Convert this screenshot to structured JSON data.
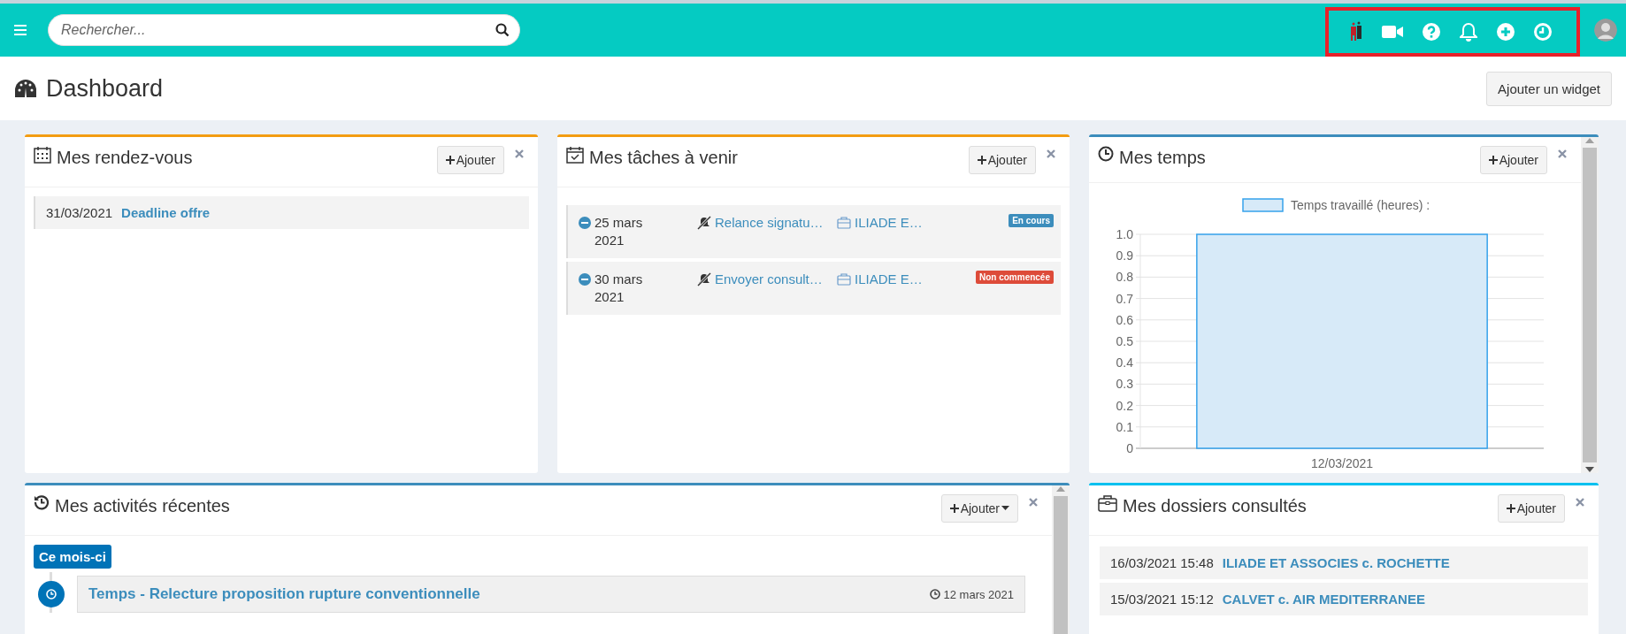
{
  "topbar": {
    "search_placeholder": "Rechercher..."
  },
  "header": {
    "title": "Dashboard",
    "add_widget_button": "Ajouter un widget"
  },
  "widgets": [
    {
      "kind": "appointments",
      "title": "Mes rendez-vous",
      "add_label": "Ajouter",
      "dropdown": false,
      "color": "#f39c12",
      "items": [
        {
          "date": "31/03/2021",
          "label": "Deadline offre"
        }
      ]
    },
    {
      "kind": "tasks",
      "title": "Mes tâches à venir",
      "add_label": "Ajouter",
      "dropdown": false,
      "color": "#f39c12",
      "tasks": [
        {
          "date": "25 mars 2021",
          "task": "Relance signatu…",
          "dossier": "ILIADE E…",
          "status": {
            "label": "En cours",
            "color": "#3c8dbc"
          }
        },
        {
          "date": "30 mars 2021",
          "task": "Envoyer consult…",
          "dossier": "ILIADE E…",
          "status": {
            "label": "Non commencée",
            "color": "#dd4b39"
          }
        }
      ]
    },
    {
      "kind": "chart",
      "title": "Mes temps",
      "add_label": "Ajouter",
      "dropdown": false,
      "color": "#3c8dbc",
      "chart_data": {
        "type": "bar",
        "categories": [
          "12/03/2021"
        ],
        "series": [
          {
            "name": "Temps travaillé (heures) :",
            "color": "#36a2eb",
            "values": [
              1
            ]
          }
        ],
        "ylim": [
          0,
          1
        ],
        "grid": true,
        "yticks": [
          {
            "value": 0,
            "label": "0"
          },
          0.1,
          0.2,
          0.3,
          0.4,
          0.5,
          0.6,
          0.7,
          0.8,
          0.9,
          {
            "value": 1,
            "label": "1.0"
          }
        ]
      }
    },
    {
      "kind": "activities",
      "title": "Mes activités récentes",
      "add_label": "Ajouter",
      "dropdown": true,
      "color": "#3c8dbc",
      "group": "Ce mois-ci",
      "items": [
        {
          "title": "Temps - Relecture proposition rupture conventionnelle",
          "date": "12 mars 2021"
        }
      ]
    },
    {
      "kind": "files",
      "title": "Mes dossiers consultés",
      "add_label": "Ajouter",
      "dropdown": false,
      "color": "#00c0ef",
      "items": [
        {
          "date": "16/03/2021 15:48",
          "name": "ILIADE ET ASSOCIES c. ROCHETTE"
        },
        {
          "date": "15/03/2021 15:12",
          "name": "CALVET c. AIR MEDITERRANEE"
        }
      ]
    }
  ]
}
